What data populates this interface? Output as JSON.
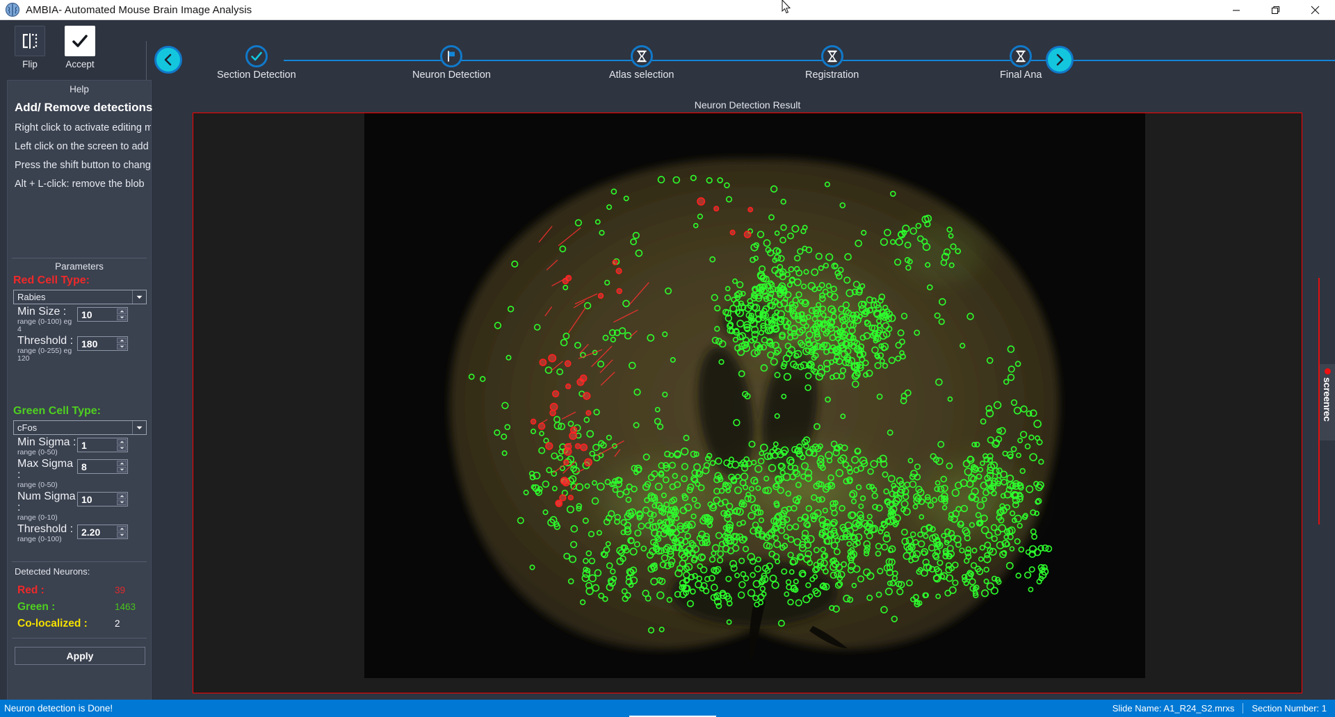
{
  "window": {
    "title": "AMBIA- Automated Mouse Brain Image Analysis",
    "logo_icon": "brain-icon",
    "minimize_icon": "minimize-icon",
    "maximize_icon": "maximize-icon",
    "close_icon": "close-icon"
  },
  "toolbar": {
    "buttons": [
      {
        "label": "Flip",
        "icon": "flip-icon"
      },
      {
        "label": "Accept",
        "icon": "check-icon"
      }
    ]
  },
  "stepper": {
    "prev_icon": "chevron-left-icon",
    "next_icon": "chevron-right-icon",
    "steps": [
      {
        "label": "Section Detection",
        "icon": "check-icon",
        "state": "done"
      },
      {
        "label": "Neuron Detection",
        "icon": "flag-icon",
        "state": "current"
      },
      {
        "label": "Atlas selection",
        "icon": "hourglass-icon",
        "state": "pending"
      },
      {
        "label": "Registration",
        "icon": "hourglass-icon",
        "state": "pending"
      },
      {
        "label": "Final Ana",
        "icon": "hourglass-icon",
        "state": "pending"
      }
    ]
  },
  "help": {
    "header": "Help",
    "title": "Add/ Remove detections",
    "lines": [
      "Right click to activate editing mod",
      "Left click on the screen to add a l",
      "Press the shift button to change tl",
      "Alt + L-click: remove the blob"
    ]
  },
  "parameters": {
    "header": "Parameters",
    "red": {
      "title": "Red Cell Type:",
      "selected": "Rabies",
      "dropdown_icon": "chevron-down-icon",
      "fields": [
        {
          "label": "Min Size :",
          "range": "range (0-100) eg 4",
          "value": "10"
        },
        {
          "label": "Threshold :",
          "range": "range (0-255) eg 120",
          "value": "180"
        }
      ]
    },
    "green": {
      "title": "Green Cell Type:",
      "selected": "cFos",
      "dropdown_icon": "chevron-down-icon",
      "fields": [
        {
          "label": "Min Sigma :",
          "range": "range (0-50)",
          "value": "1"
        },
        {
          "label": "Max Sigma :",
          "range": "range (0-50)",
          "value": "8"
        },
        {
          "label": "Num Sigma :",
          "range": "range (0-10)",
          "value": "10"
        },
        {
          "label": "Threshold :",
          "range": "range (0-100)",
          "value": "2.20"
        }
      ]
    }
  },
  "detected": {
    "header": "Detected Neurons:",
    "rows": [
      {
        "name": "Red :",
        "value": "39"
      },
      {
        "name": "Green :",
        "value": "1463"
      },
      {
        "name": "Co-localized :",
        "value": "2"
      }
    ]
  },
  "apply_button": "Apply",
  "viewer": {
    "title": "Neuron Detection Result",
    "border_color": "#ff0000"
  },
  "watermark": {
    "text": "screenrec",
    "dot_icon": "record-dot-icon"
  },
  "status": {
    "message": "Neuron detection is Done!",
    "slide_name": "Slide Name: A1_R24_S2.mrxs",
    "section_number": "Section Number: 1"
  },
  "colors": {
    "accent": "#0078d4",
    "cyan": "#13c6de",
    "step_blue": "#1179c9",
    "red": "#ef2929",
    "green": "#4fd020",
    "yellow": "#f4e000",
    "panel": "#3a414f",
    "background": "#2e3440"
  }
}
